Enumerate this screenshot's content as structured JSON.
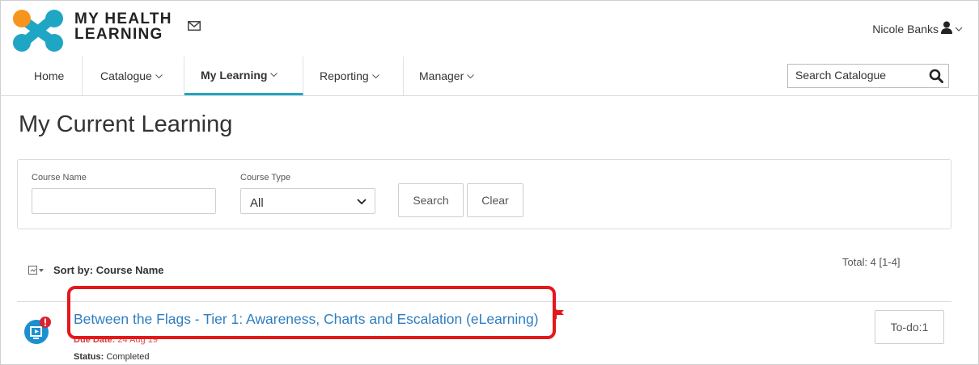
{
  "app": {
    "brand_line1": "MY HEALTH",
    "brand_line2": "LEARNING",
    "user_name": "Nicole Banks"
  },
  "nav": {
    "items": [
      {
        "label": "Home"
      },
      {
        "label": "Catalogue"
      },
      {
        "label": "My Learning",
        "active": true
      },
      {
        "label": "Reporting"
      },
      {
        "label": "Manager"
      }
    ],
    "search_placeholder": "Search Catalogue"
  },
  "page": {
    "title": "My Current Learning"
  },
  "filters": {
    "course_name_label": "Course Name",
    "course_name_value": "",
    "course_type_label": "Course Type",
    "course_type_value": "All",
    "search_label": "Search",
    "clear_label": "Clear"
  },
  "results": {
    "total": "Total: 4 [1-4]",
    "sort_label": "Sort by: Course Name"
  },
  "courses": [
    {
      "title": "Between the Flags - Tier 1: Awareness, Charts and Escalation (eLearning)",
      "due_label": "Due Date:",
      "due_value": "24 Aug 19",
      "status_label": "Status:",
      "status_value": "Completed",
      "action_label": "To-do:1"
    }
  ],
  "colors": {
    "accent": "#1fa6c4",
    "link": "#2f7ec0",
    "logo_orange": "#f7941d",
    "logo_teal": "#1fa6c4",
    "highlight": "#e4171b",
    "alert": "#d9232d"
  },
  "icons": [
    "logo-icon",
    "mail-icon",
    "user-icon",
    "chevron-down-icon",
    "search-icon",
    "sort-icon",
    "elearning-icon",
    "alert-icon",
    "flag-icon"
  ]
}
